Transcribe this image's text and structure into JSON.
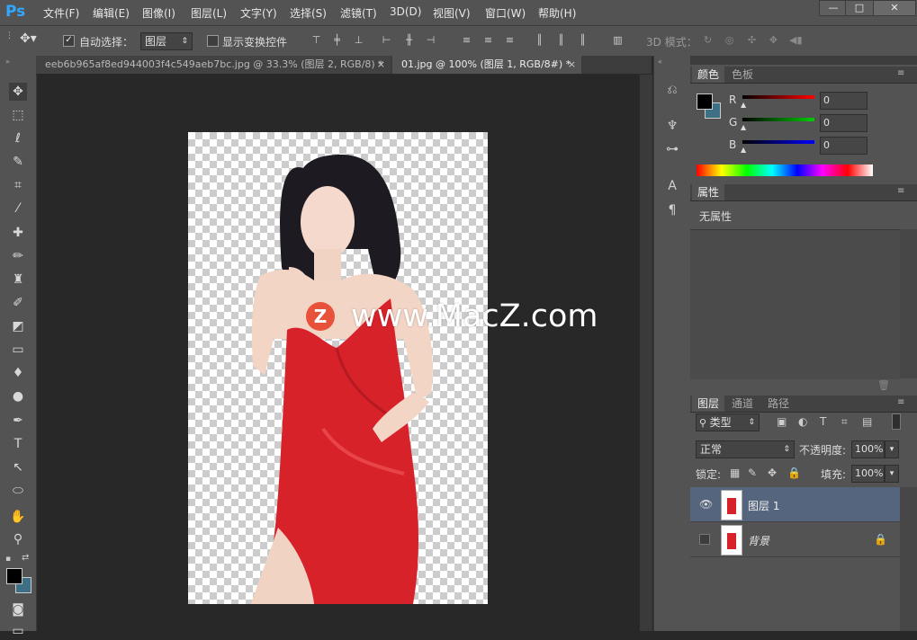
{
  "app": {
    "logo": "Ps"
  },
  "menu": [
    "文件(F)",
    "编辑(E)",
    "图像(I)",
    "图层(L)",
    "文字(Y)",
    "选择(S)",
    "滤镜(T)",
    "3D(D)",
    "视图(V)",
    "窗口(W)",
    "帮助(H)"
  ],
  "window_controls": {
    "minimize": "—",
    "maximize": "□",
    "close": "✕"
  },
  "options": {
    "auto_select_label": "自动选择：",
    "auto_select_checked": "✓",
    "auto_select_value": "图层",
    "show_transform_label": "显示变换控件",
    "mode_3d_label": "3D 模式："
  },
  "tabs": [
    {
      "label": "eeb6b965af8ed944003f4c549aeb7bc.jpg @ 33.3% (图层 2, RGB/8) *",
      "close": "×"
    },
    {
      "label": "01.jpg @ 100% (图层 1, RGB/8#) *",
      "close": "×"
    }
  ],
  "canvas": {
    "watermark_text": "www.MacZ.com",
    "watermark_logo": "Z"
  },
  "color_panel": {
    "tabs": [
      "颜色",
      "色板"
    ],
    "r_label": "R",
    "g_label": "G",
    "b_label": "B",
    "r_value": "0",
    "g_value": "0",
    "b_value": "0"
  },
  "properties_panel": {
    "tab": "属性",
    "content": "无属性"
  },
  "layers_panel": {
    "tabs": [
      "图层",
      "通道",
      "路径"
    ],
    "filter_label": "类型",
    "blend_mode": "正常",
    "opacity_label": "不透明度:",
    "opacity_value": "100%",
    "lock_label": "锁定:",
    "fill_label": "填充:",
    "fill_value": "100%",
    "layers": [
      {
        "name": "图层 1",
        "visible": "true",
        "selected": "true"
      },
      {
        "name": "背景",
        "visible": "false",
        "selected": "false"
      }
    ]
  },
  "colors": {
    "accent": "#31a8ff",
    "selected_layer": "#56657e",
    "watermark_logo": "#e8513a",
    "dress_red": "#d8222a"
  }
}
